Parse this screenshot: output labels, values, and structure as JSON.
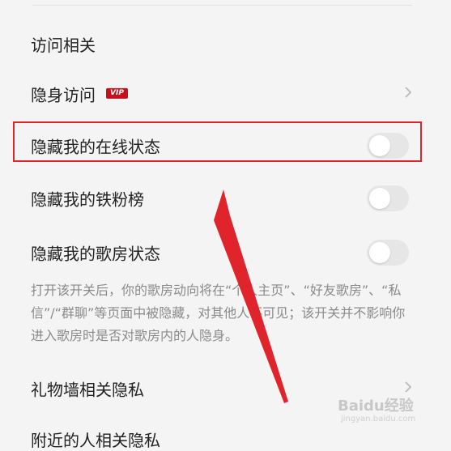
{
  "section": {
    "title": "访问相关"
  },
  "items": [
    {
      "label": "隐身访问",
      "badge": "VIP",
      "control": "chevron"
    },
    {
      "label": "隐藏我的在线状态",
      "control": "toggle",
      "on": false
    },
    {
      "label": "隐藏我的铁粉榜",
      "control": "toggle",
      "on": false
    },
    {
      "label": "隐藏我的歌房状态",
      "control": "toggle",
      "on": false
    }
  ],
  "description": "打开该开关后，你的歌房动向将在“个人主页”、“好友歌房”、“私信”/“群聊”等页面中被隐藏，对其他人不可见；该开关并不影响你进入歌房时是否对歌房内的人隐身。",
  "gift_wall": {
    "label": "礼物墙相关隐私"
  },
  "next_partial": {
    "label": "附近的人相关隐私"
  },
  "watermark": {
    "text": "Baidu经验",
    "sub": "jingyan.baidu.com"
  },
  "colors": {
    "background": "#f4f4f4",
    "highlight": "#e0242b",
    "vip_badge": "#c8101a",
    "toggle_off": "#e6e6e6",
    "annotation_arrow": "#e0242b"
  }
}
